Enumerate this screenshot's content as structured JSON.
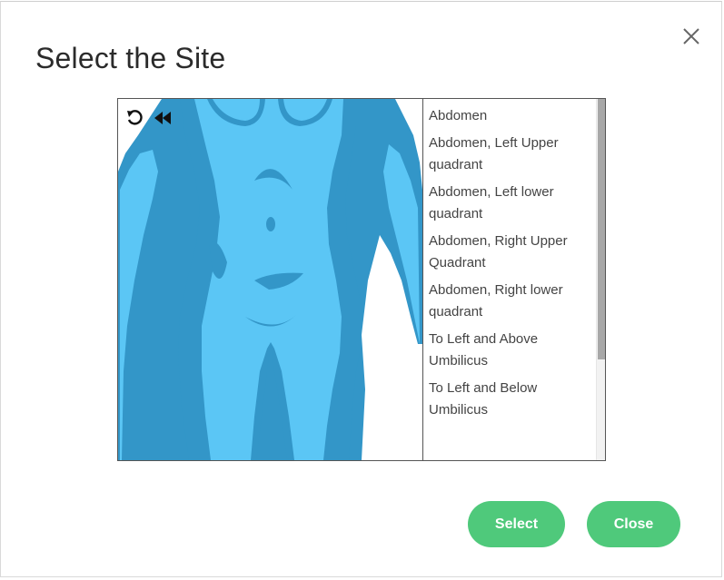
{
  "dialog": {
    "title": "Select the Site",
    "close_icon": "close-x-icon"
  },
  "toolbar": {
    "undo_icon": "undo-icon",
    "rewind_icon": "rewind-icon"
  },
  "colors": {
    "body_fill": "#5bc6f5",
    "body_shade": "#3396c8",
    "button": "#4fc97b"
  },
  "sites": [
    {
      "label": "Abdomen"
    },
    {
      "label": "Abdomen, Left Upper quadrant"
    },
    {
      "label": "Abdomen, Left lower quadrant"
    },
    {
      "label": "Abdomen, Right Upper Quadrant"
    },
    {
      "label": "Abdomen, Right lower quadrant"
    },
    {
      "label": "To Left and Above Umbilicus"
    },
    {
      "label": "To Left and Below Umbilicus"
    }
  ],
  "buttons": {
    "select": "Select",
    "close": "Close"
  }
}
